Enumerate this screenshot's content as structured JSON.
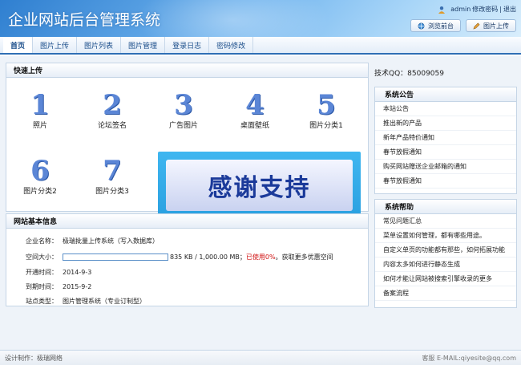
{
  "header": {
    "title": "企业网站后台管理系统",
    "user": "admin",
    "change_password": "修改密码",
    "separator": "|",
    "logout": "退出",
    "preview_button": "浏览前台",
    "upload_button": "图片上传",
    "icons": {
      "user": "user-icon",
      "preview": "globe-icon",
      "upload": "pencil-icon"
    }
  },
  "nav": {
    "tabs": [
      "首页",
      "图片上传",
      "图片列表",
      "图片管理",
      "登录日志",
      "密码修改"
    ],
    "active": 0
  },
  "quick": {
    "title": "快速上传",
    "items": [
      {
        "num": "1",
        "label": "照片"
      },
      {
        "num": "2",
        "label": "论坛签名"
      },
      {
        "num": "3",
        "label": "广告图片"
      },
      {
        "num": "4",
        "label": "桌面壁纸"
      },
      {
        "num": "5",
        "label": "图片分类1"
      },
      {
        "num": "6",
        "label": "图片分类2"
      },
      {
        "num": "7",
        "label": "图片分类3"
      }
    ]
  },
  "banner": {
    "text": "感谢支持"
  },
  "info": {
    "title": "网站基本信息",
    "company_label": "企业名称：",
    "company_value": "极瑞批量上传系统（写入数据库）",
    "space_label": "空间大小：",
    "space_used_fraction": 0.0,
    "space_value": "835 KB / 1,000.00 MB；",
    "space_used": "已使用0%",
    "space_more": "。获取更多优惠空间",
    "open_label": "开通时间：",
    "open_value": "2014-9-3",
    "expire_label": "到期时间：",
    "expire_value": "2015-9-2",
    "type_label": "站点类型：",
    "type_value": "图片管理系统（专业订制型）"
  },
  "support": {
    "qq": "技术QQ：85009059"
  },
  "announce": {
    "title": "系统公告",
    "items": [
      "本站公告",
      "推出新的产品",
      "新年产品特价通知",
      "春节放假通知",
      "购买网站赠送企业邮箱的通知",
      "春节放假通知"
    ]
  },
  "help": {
    "title": "系统帮助",
    "items": [
      "常见问题汇总",
      "菜单设置如何管理，都有哪些用途。",
      "自定义单页的功能都有那些，如何拓展功能",
      "内容太多如何进行静态生成",
      "如何才能让网站被搜索引擎收录的更多",
      "备案流程"
    ]
  },
  "footer": {
    "left": "设计制作：极瑞网络",
    "right": "客服 E-MAIL:qiyesite@qq.com"
  },
  "colors": {
    "accent": "#2f6fb5",
    "number": "#5b86d6",
    "warning": "#d01010"
  }
}
